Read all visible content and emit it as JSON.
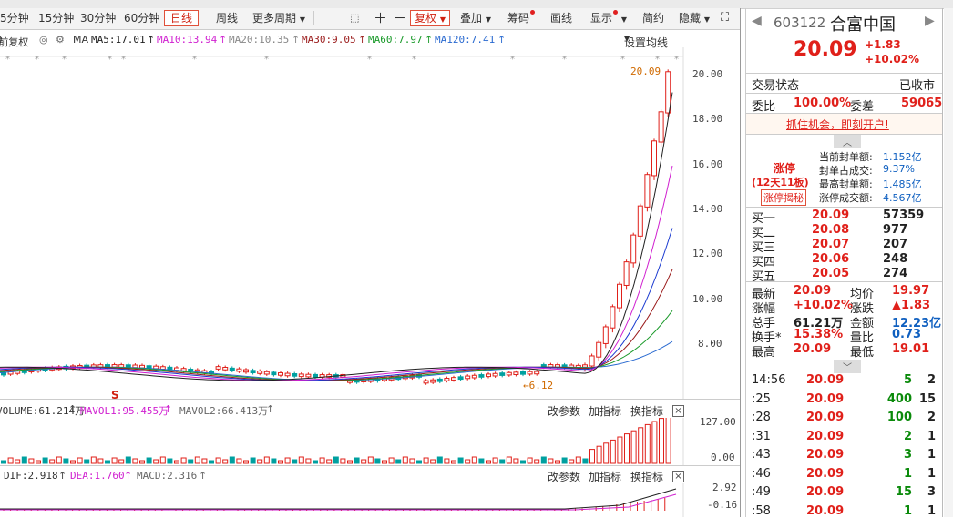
{
  "toolbar": {
    "items": [
      "5分钟",
      "15分钟",
      "30分钟",
      "60分钟",
      "日线",
      "周线",
      "更多周期",
      "复权",
      "叠加",
      "筹码",
      "画线",
      "显示",
      "简约",
      "隐藏"
    ],
    "active": "日线"
  },
  "ma": {
    "prefix": "前复权",
    "label": "MA",
    "ma5": "MA5:17.01",
    "ma10": "MA10:13.94",
    "ma20": "MA20:10.35",
    "ma30": "MA30:9.05",
    "ma60": "MA60:7.97",
    "ma120": "MA120:7.41",
    "settings": "设置均线"
  },
  "colors": {
    "up": "#e0201a",
    "down": "#00a0a0",
    "ma5": "#202020",
    "ma10": "#d020d0",
    "ma20": "#1a3ad0",
    "ma30": "#9a1a1a",
    "ma60": "#1a9a2a",
    "ma120": "#2a6ad0"
  },
  "chart_data": {
    "type": "candlestick",
    "price_axis": [
      "20.00",
      "18.00",
      "16.00",
      "14.00",
      "12.00",
      "10.00",
      "8.00"
    ],
    "high_label": "20.09",
    "low_label": "6.12",
    "marker": "S",
    "volume": {
      "title": "VOLUME:61.214万",
      "mavol1": "MAVOL1:95.455万",
      "mavol2": "MAVOL2:66.413万",
      "axis": [
        "127.00",
        "0.00"
      ]
    },
    "macd": {
      "dif": "DIF:2.918",
      "dea": "DEA:1.760",
      "macd": "MACD:2.316",
      "axis": [
        "2.92",
        "-0.16"
      ]
    }
  },
  "panel_buttons": {
    "params": "改参数",
    "add": "加指标",
    "swap": "换指标",
    "close": "×"
  },
  "quote": {
    "code": "603122",
    "name": "合富中国",
    "price": "20.09",
    "change": "+1.83",
    "pct": "+10.02%",
    "state_label": "交易状态",
    "state_value": "已收市",
    "weibi_label": "委比",
    "weibi": "100.00%",
    "weicha_label": "委差",
    "weicha": "59065",
    "ad": "抓住机会，即刻开户!",
    "limit": {
      "tag": "涨停",
      "days": "(12天11板)",
      "reveal": "涨停揭秘",
      "rows": [
        {
          "label": "当前封单额:",
          "value": "1.152亿"
        },
        {
          "label": "封单占成交:",
          "value": "9.37%"
        },
        {
          "label": "最高封单额:",
          "value": "1.485亿"
        },
        {
          "label": "涨停成交额:",
          "value": "4.567亿"
        }
      ]
    },
    "buys": [
      {
        "label": "买一",
        "price": "20.09",
        "vol": "57359"
      },
      {
        "label": "买二",
        "price": "20.08",
        "vol": "977"
      },
      {
        "label": "买三",
        "price": "20.07",
        "vol": "207"
      },
      {
        "label": "买四",
        "price": "20.06",
        "vol": "248"
      },
      {
        "label": "买五",
        "price": "20.05",
        "vol": "274"
      }
    ],
    "stats": [
      {
        "l1": "最新",
        "v1": "20.09",
        "l2": "均价",
        "v2": "19.97"
      },
      {
        "l1": "涨幅",
        "v1": "+10.02%",
        "l2": "涨跌",
        "v2": "▲1.83"
      },
      {
        "l1": "总手",
        "v1": "61.21万",
        "l2": "金额",
        "v2": "12.23亿"
      },
      {
        "l1": "换手*",
        "v1": "15.38%",
        "l2": "量比",
        "v2": "0.73"
      },
      {
        "l1": "最高",
        "v1": "20.09",
        "l2": "最低",
        "v2": "19.01"
      }
    ],
    "ticks": [
      {
        "t": "14:56",
        "p": "20.09",
        "v": "5",
        "n": "2"
      },
      {
        "t": ":25",
        "p": "20.09",
        "v": "400",
        "n": "15"
      },
      {
        "t": ":28",
        "p": "20.09",
        "v": "100",
        "n": "2"
      },
      {
        "t": ":31",
        "p": "20.09",
        "v": "2",
        "n": "1"
      },
      {
        "t": ":43",
        "p": "20.09",
        "v": "3",
        "n": "1"
      },
      {
        "t": ":46",
        "p": "20.09",
        "v": "1",
        "n": "1"
      },
      {
        "t": ":49",
        "p": "20.09",
        "v": "15",
        "n": "3"
      },
      {
        "t": ":58",
        "p": "20.09",
        "v": "1",
        "n": "1"
      }
    ]
  }
}
